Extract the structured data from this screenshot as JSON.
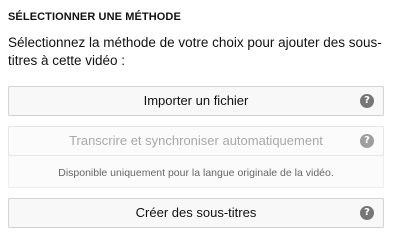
{
  "section": {
    "title": "SÉLECTIONNER UNE MÉTHODE",
    "intro": "Sélectionnez la méthode de votre choix pour ajouter des sous-titres à cette vidéo :"
  },
  "options": [
    {
      "label": "Importer un fichier",
      "enabled": true,
      "help_icon": "question-mark-circle-icon"
    },
    {
      "label": "Transcrire et synchroniser automatiquement",
      "enabled": false,
      "help_icon": "question-mark-circle-icon",
      "note": "Disponible uniquement pour la langue originale de la vidéo."
    },
    {
      "label": "Créer des sous-titres",
      "enabled": true,
      "help_icon": "question-mark-circle-icon"
    }
  ],
  "help_glyph": "?",
  "colors": {
    "text": "#111111",
    "disabled_text": "#a9a9a9",
    "button_bg": "#f8f8f8",
    "button_border": "#d3d3d3",
    "help_icon_bg": "#767676"
  }
}
